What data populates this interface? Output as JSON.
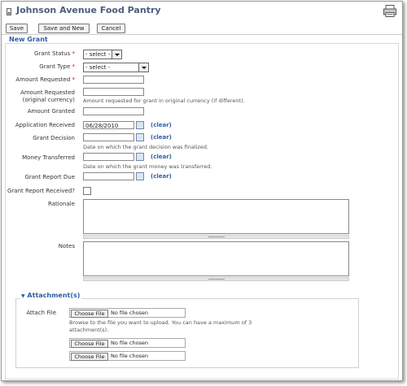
{
  "app": {
    "title": "Johnson Avenue Food Pantry"
  },
  "icons": {
    "page": "page-icon",
    "print": "print-icon"
  },
  "toolbar": {
    "save_label": "Save",
    "save_new_label": "Save and New",
    "cancel_label": "Cancel"
  },
  "section": {
    "title": "New Grant"
  },
  "fields": {
    "grant_status": {
      "label": "Grant Status",
      "required": "*",
      "value": "- select -"
    },
    "grant_type": {
      "label": "Grant Type",
      "required": "*",
      "value": "- select -"
    },
    "amount_requested": {
      "label": "Amount Requested",
      "required": "*",
      "value": ""
    },
    "amount_requested_orig": {
      "label_line1": "Amount Requested",
      "label_line2": "(original currency)",
      "value": "",
      "hint": "Amount requested for grant in original currency (if different)."
    },
    "amount_granted": {
      "label": "Amount Granted",
      "value": ""
    },
    "application_received": {
      "label": "Application Received",
      "value": "06/28/2010",
      "clear": "(clear)"
    },
    "grant_decision": {
      "label": "Grant Decision",
      "value": "",
      "clear": "(clear)",
      "hint": "Date on which the grant decision was finalized."
    },
    "money_transferred": {
      "label": "Money Transferred",
      "value": "",
      "clear": "(clear)",
      "hint": "Date on which the grant money was transferred."
    },
    "grant_report_due": {
      "label": "Grant Report Due",
      "value": "",
      "clear": "(clear)"
    },
    "grant_report_received": {
      "label": "Grant Report Received?",
      "checked": false
    },
    "rationale": {
      "label": "Rationale",
      "value": ""
    },
    "notes": {
      "label": "Notes",
      "value": ""
    }
  },
  "attachments": {
    "title": "Attachment(s)",
    "attach_label": "Attach File",
    "choose_label": "Choose File",
    "no_file": "No file chosen",
    "hint_line1": "Browse to the file you want to upload. You can have a maximum of 3",
    "hint_line2": "attachment(s)."
  }
}
